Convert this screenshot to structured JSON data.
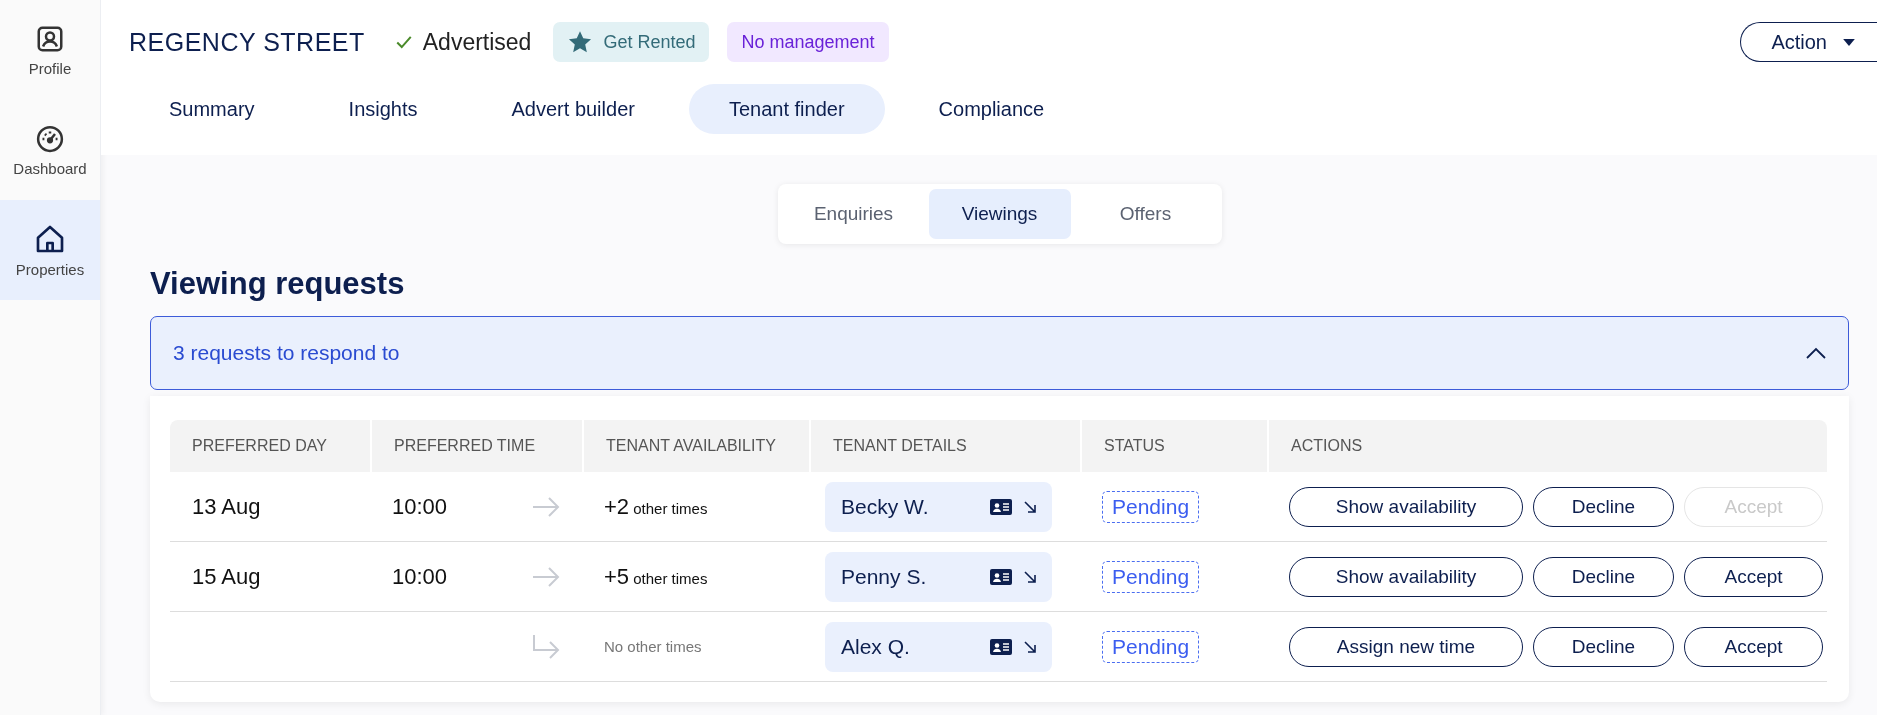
{
  "sidebar": {
    "items": [
      {
        "label": "Profile",
        "kind": "profile",
        "selected": false
      },
      {
        "label": "Dashboard",
        "kind": "gauge",
        "selected": false
      },
      {
        "label": "Properties",
        "kind": "home",
        "selected": true
      }
    ]
  },
  "header": {
    "title": "REGENCY STREET",
    "status": "Advertised",
    "badges": [
      {
        "text": "Get Rented",
        "kind": "rented"
      },
      {
        "text": "No management",
        "kind": "management"
      }
    ],
    "action_button": "Action"
  },
  "tabs": [
    {
      "label": "Summary",
      "selected": false
    },
    {
      "label": "Insights",
      "selected": false
    },
    {
      "label": "Advert builder",
      "selected": false
    },
    {
      "label": "Tenant finder",
      "selected": true
    },
    {
      "label": "Compliance",
      "selected": false
    }
  ],
  "subtabs": [
    {
      "label": "Enquiries",
      "selected": false
    },
    {
      "label": "Viewings",
      "selected": true
    },
    {
      "label": "Offers",
      "selected": false
    }
  ],
  "heading": "Viewing requests",
  "accordion": {
    "text": "3 requests to respond to",
    "expanded": true
  },
  "table": {
    "columns": [
      "PREFERRED DAY",
      "PREFERRED TIME",
      "TENANT AVAILABILITY",
      "TENANT DETAILS",
      "STATUS",
      "ACTIONS"
    ],
    "rows": [
      {
        "day": "13 Aug",
        "time": "10:00",
        "kind": "arrow",
        "count": "+2",
        "availability": "other times",
        "tenant": "Becky W.",
        "status": "Pending",
        "actions": [
          {
            "label": "Show availability",
            "disabled": false
          },
          {
            "label": "Decline",
            "disabled": false
          },
          {
            "label": "Accept",
            "disabled": true
          }
        ]
      },
      {
        "day": "15 Aug",
        "time": "10:00",
        "kind": "arrow",
        "count": "+5",
        "availability": "other times",
        "tenant": "Penny S.",
        "status": "Pending",
        "actions": [
          {
            "label": "Show availability",
            "disabled": false
          },
          {
            "label": "Decline",
            "disabled": false
          },
          {
            "label": "Accept",
            "disabled": false
          }
        ]
      },
      {
        "kind": "return",
        "availability": "No other times",
        "tenant": "Alex Q.",
        "status": "Pending",
        "actions": [
          {
            "label": "Assign new time",
            "disabled": false
          },
          {
            "label": "Decline",
            "disabled": false
          },
          {
            "label": "Accept",
            "disabled": false
          }
        ]
      }
    ]
  }
}
